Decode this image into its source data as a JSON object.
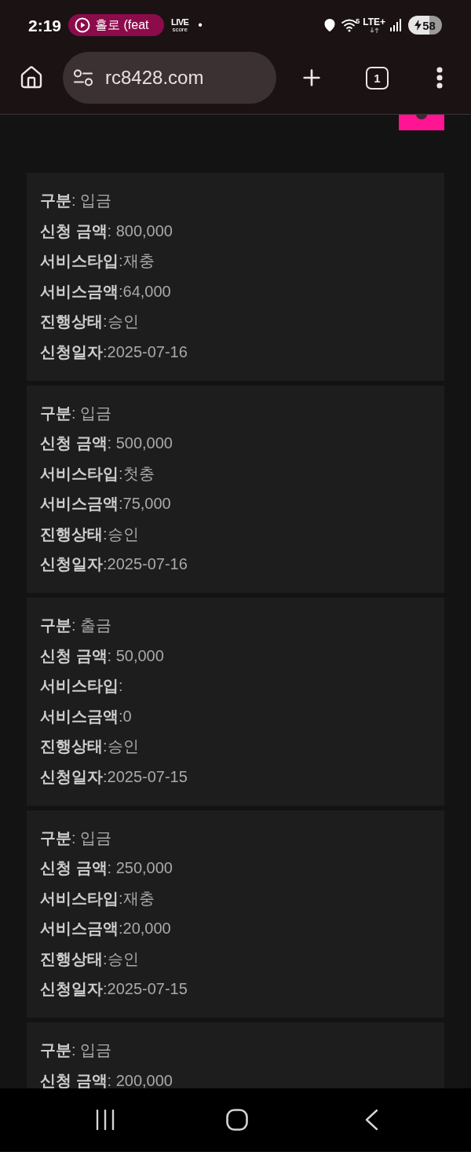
{
  "status_bar": {
    "time": "2:19",
    "media_chip": {
      "title": "홀로 (feat"
    },
    "notification_app": {
      "line_1": "LIVE",
      "line_2": "score"
    },
    "more_indicator": "•",
    "wifi_band": "5",
    "network_type": "LTE+",
    "battery_percent": "58"
  },
  "browser_toolbar": {
    "url": "rc8428.com",
    "tab_count": "1"
  },
  "records": [
    {
      "fields": [
        "**구분**: 입금",
        "**신청 금액**: 800,000",
        "**서비스타입**:재충",
        "**서비스금액**:64,000",
        "**진행상태**:승인",
        "**신청일자**:2025-07-16"
      ]
    },
    {
      "fields": [
        "**구분**: 입금",
        "**신청 금액**: 500,000",
        "**서비스타입**:첫충",
        "**서비스금액**:75,000",
        "**진행상태**:승인",
        "**신청일자**:2025-07-16"
      ]
    },
    {
      "fields": [
        "**구분**: 출금",
        "**신청 금액**: 50,000",
        "**서비스타입**:",
        "**서비스금액**:0",
        "**진행상태**:승인",
        "**신청일자**:2025-07-15"
      ]
    },
    {
      "fields": [
        "**구분**: 입금",
        "**신청 금액**: 250,000",
        "**서비스타입**:재충",
        "**서비스금액**:20,000",
        "**진행상태**:승인",
        "**신청일자**:2025-07-15"
      ]
    },
    {
      "fields": [
        "**구분**: 입금",
        "**신청 금액**: 200,000"
      ]
    }
  ]
}
